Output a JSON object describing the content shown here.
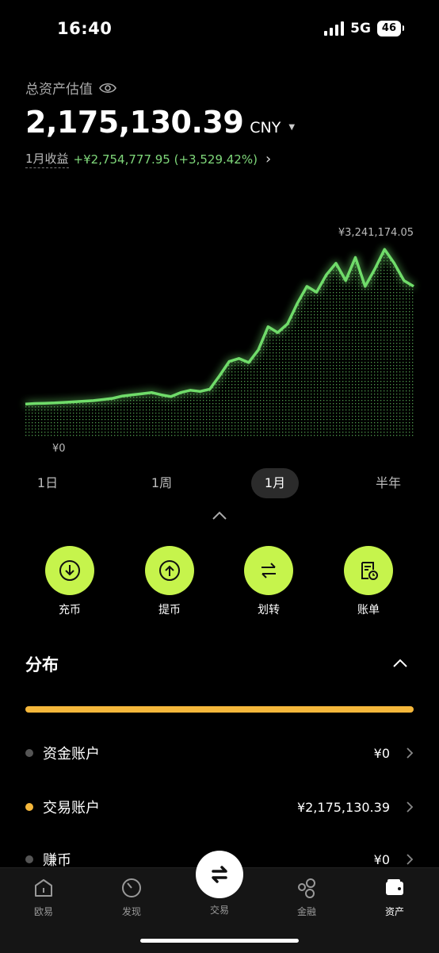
{
  "status": {
    "time": "16:40",
    "network": "5G",
    "battery": "46"
  },
  "header": {
    "label": "总资产估值",
    "balance": "2,175,130.39",
    "unit": "CNY",
    "pnl_label": "1月收益",
    "pnl_value": "+¥2,754,777.95 (+3,529.42%)"
  },
  "chart_data": {
    "type": "area",
    "max_label": "¥3,241,174.05",
    "min_label": "¥0",
    "ylim": [
      0,
      3300000
    ],
    "color": "#6fdc6a",
    "values": [
      560000,
      570000,
      575000,
      580000,
      590000,
      600000,
      610000,
      620000,
      640000,
      660000,
      700000,
      720000,
      740000,
      760000,
      720000,
      690000,
      760000,
      800000,
      780000,
      820000,
      1050000,
      1300000,
      1350000,
      1280000,
      1500000,
      1900000,
      1800000,
      1950000,
      2300000,
      2600000,
      2500000,
      2800000,
      3000000,
      2700000,
      3100000,
      2600000,
      2900000,
      3241174,
      3000000,
      2700000,
      2600000
    ]
  },
  "periods": [
    "1日",
    "1周",
    "1月",
    "半年"
  ],
  "active_period": "1月",
  "actions": [
    {
      "label": "充币",
      "icon": "deposit-icon"
    },
    {
      "label": "提币",
      "icon": "withdraw-icon"
    },
    {
      "label": "划转",
      "icon": "transfer-icon"
    },
    {
      "label": "账单",
      "icon": "bill-icon"
    }
  ],
  "distribution": {
    "title": "分布",
    "accounts": [
      {
        "name": "资金账户",
        "value": "¥0",
        "color": "#555555"
      },
      {
        "name": "交易账户",
        "value": "¥2,175,130.39",
        "color": "#f5b73b"
      },
      {
        "name": "赚币",
        "value": "¥0",
        "color": "#555555"
      }
    ]
  },
  "nav": [
    {
      "label": "欧易",
      "icon": "home-icon"
    },
    {
      "label": "发现",
      "icon": "discover-icon"
    },
    {
      "label": "交易",
      "icon": "trade-icon"
    },
    {
      "label": "金融",
      "icon": "finance-icon"
    },
    {
      "label": "资产",
      "icon": "wallet-icon"
    }
  ],
  "nav_active": "资产"
}
